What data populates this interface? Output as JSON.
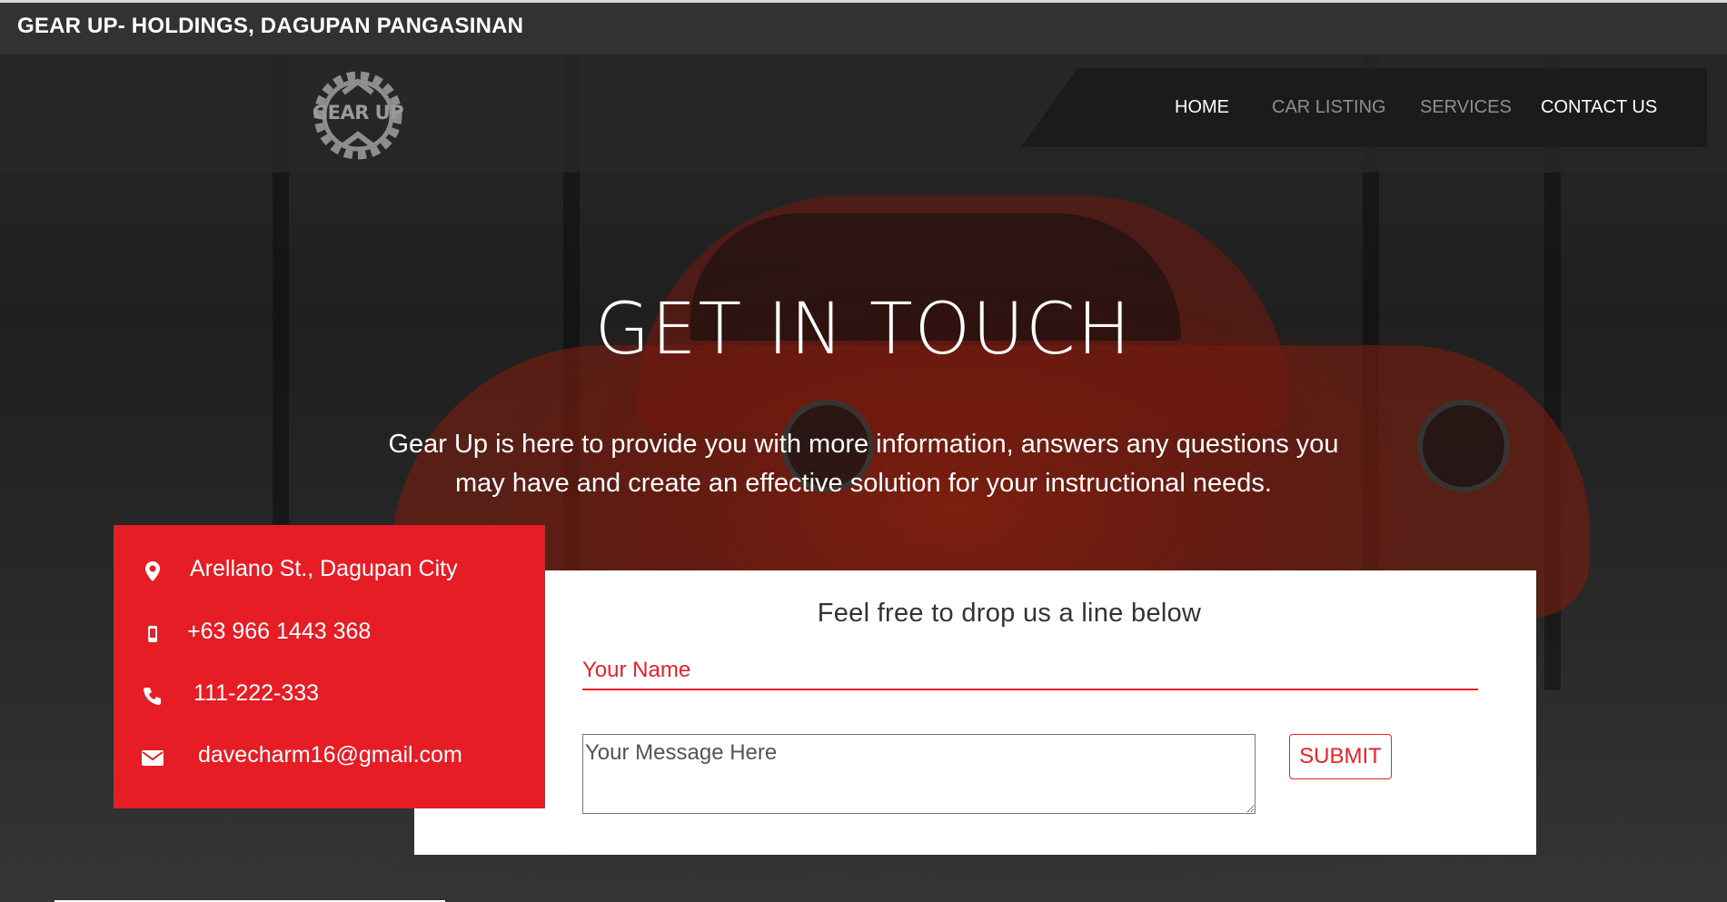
{
  "topbar": {
    "site_title": "GEAR UP- HOLDINGS, DAGUPAN PANGASINAN"
  },
  "header": {
    "logo_text": "GEAR UP",
    "nav": [
      {
        "label": "HOME",
        "active": true
      },
      {
        "label": "CAR LISTING",
        "active": false
      },
      {
        "label": "SERVICES",
        "active": false
      },
      {
        "label": "CONTACT US",
        "active": true
      }
    ]
  },
  "hero": {
    "title": "GET IN TOUCH",
    "subtitle": "Gear Up is here to provide you with more information, answers any questions you may have and create an effective solution for your instructional needs."
  },
  "contact": {
    "address": "Arellano St., Dagupan City",
    "mobile": "+63 966 1443 368",
    "phone": "111-222-333",
    "email": "davecharm16@gmail.com",
    "icons": [
      "map-pin-icon",
      "mobile-icon",
      "phone-icon",
      "envelope-icon"
    ]
  },
  "form": {
    "heading": "Feel free to drop us a line below",
    "name_placeholder": "Your Name",
    "message_placeholder": "Your Message Here",
    "submit_label": "SUBMIT"
  },
  "colors": {
    "accent_red": "#e71d25",
    "nav_bg": "#1c1b1b",
    "topbar_bg": "#333233"
  }
}
